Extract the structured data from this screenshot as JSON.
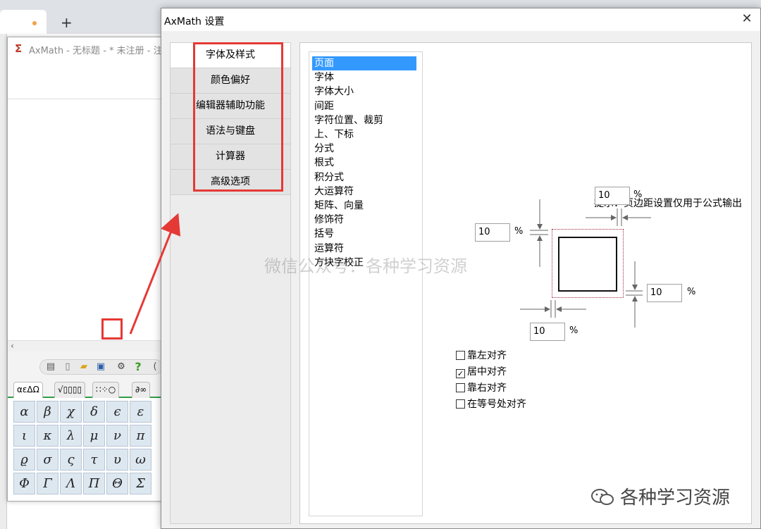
{
  "browser": {
    "new_tab": "+"
  },
  "axmath": {
    "title": "AxMath - 无标题 - * 未注册 - 注",
    "logo": "Σ",
    "symbol_tabs": [
      "αεΔΩ",
      "√▯▯▯▯",
      "∷⁘○",
      "∂∞"
    ],
    "symbols": [
      [
        "α",
        "β",
        "χ",
        "δ",
        "ϵ",
        "ε"
      ],
      [
        "ι",
        "κ",
        "λ",
        "μ",
        "ν",
        "π"
      ],
      [
        "ϱ",
        "σ",
        "ς",
        "τ",
        "υ",
        "ω"
      ],
      [
        "Φ",
        "Γ",
        "Λ",
        "Π",
        "Θ",
        "Σ"
      ]
    ]
  },
  "dialog": {
    "title": "AxMath 设置",
    "close": "✕",
    "nav": [
      {
        "label": "字体及样式",
        "active": true
      },
      {
        "label": "颜色偏好",
        "active": false
      },
      {
        "label": "编辑器辅助功能",
        "active": false
      },
      {
        "label": "语法与键盘",
        "active": false
      },
      {
        "label": "计算器",
        "active": false
      },
      {
        "label": "高级选项",
        "active": false
      }
    ],
    "list": [
      "页面",
      "字体",
      "字体大小",
      "间距",
      "字符位置、裁剪",
      "上、下标",
      "分式",
      "根式",
      "积分式",
      "大运算符",
      "矩阵、向量",
      "修饰符",
      "括号",
      "运算符",
      "方块字校正"
    ],
    "selected_index": 0,
    "hint": "提示：页边距设置仅用于公式输出",
    "margins": {
      "top": "10",
      "left": "10",
      "right": "10",
      "bottom": "10",
      "unit": "%"
    },
    "checkboxes": [
      {
        "label": "靠左对齐",
        "checked": false
      },
      {
        "label": "居中对齐",
        "checked": true
      },
      {
        "label": "靠右对齐",
        "checked": false
      },
      {
        "label": "在等号处对齐",
        "checked": false
      }
    ]
  },
  "watermark": "微信公众号：各种学习资源",
  "wechat_label": "各种学习资源",
  "colors": {
    "highlight": "#e53935",
    "selection": "#3399ff",
    "accent_green": "#2f9e44"
  }
}
